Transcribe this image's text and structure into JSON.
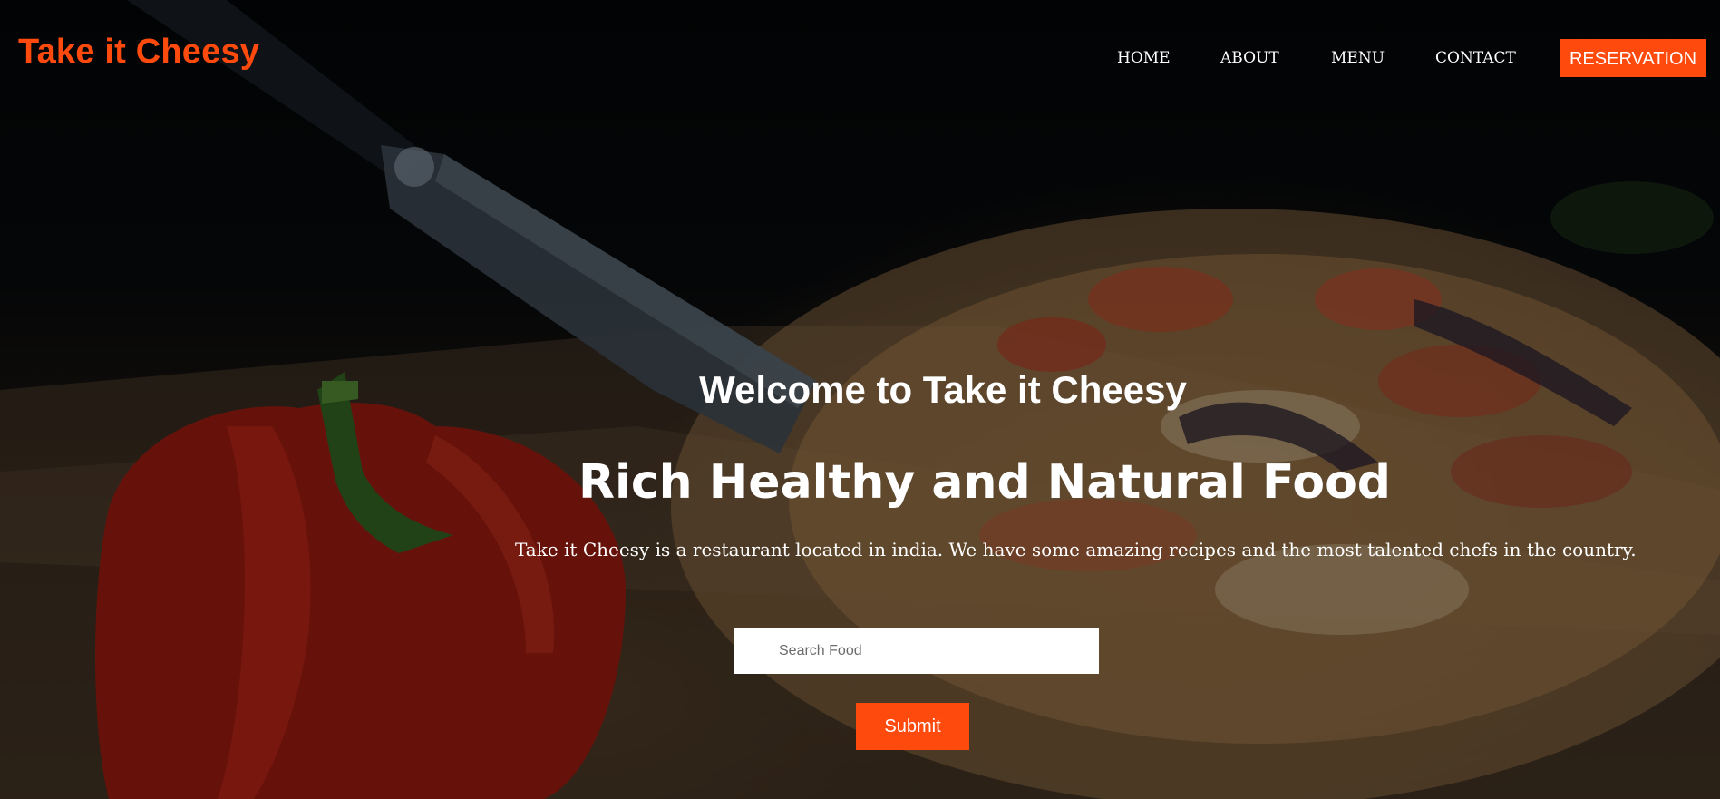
{
  "brand": {
    "name": "Take it Cheesy",
    "accent_color": "#ff4a0e"
  },
  "nav": {
    "home": "HOME",
    "about": "ABOUT",
    "menu": "MENU",
    "contact": "CONTACT",
    "reservation": "RESERVATION"
  },
  "hero": {
    "welcome": "Welcome to Take it Cheesy",
    "headline": "Rich Healthy and Natural Food",
    "tagline": "Take it Cheesy is a restaurant located in india. We have some amazing recipes and the most talented chefs in the country."
  },
  "search": {
    "placeholder": "Search Food",
    "value": "",
    "submit_label": "Submit"
  }
}
